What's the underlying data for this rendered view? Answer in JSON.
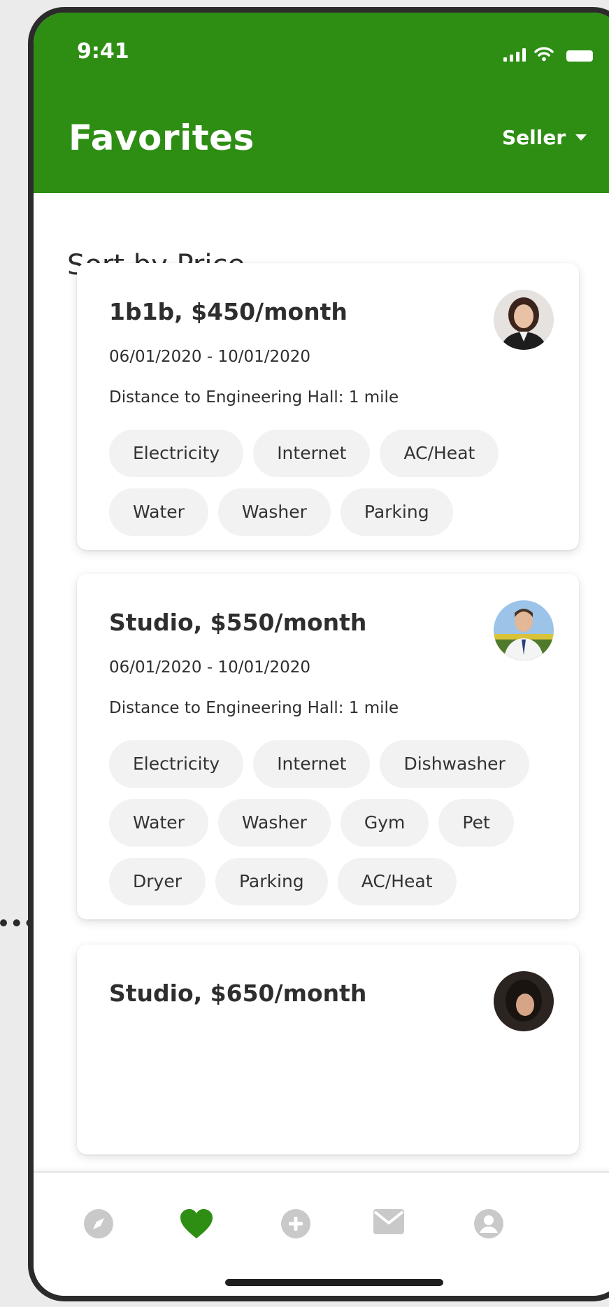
{
  "status": {
    "time": "9:41"
  },
  "header": {
    "title": "Favorites",
    "role": "Seller"
  },
  "sort": {
    "label": "Sort by Price"
  },
  "listings": [
    {
      "title": "1b1b, $450/month",
      "dates": "06/01/2020 - 10/01/2020",
      "distance": "Distance to Engineering Hall: 1 mile",
      "tags": [
        "Electricity",
        "Internet",
        "AC/Heat",
        "Water",
        "Washer",
        "Parking"
      ]
    },
    {
      "title": "Studio, $550/month",
      "dates": "06/01/2020 - 10/01/2020",
      "distance": "Distance to Engineering Hall: 1 mile",
      "tags": [
        "Electricity",
        "Internet",
        "Dishwasher",
        "Water",
        "Washer",
        "Gym",
        "Pet",
        "Dryer",
        "Parking",
        "AC/Heat"
      ]
    },
    {
      "title": "Studio, $650/month"
    }
  ],
  "tabbar": {
    "active": "favorites",
    "items": [
      "explore-icon",
      "heart-icon",
      "add-icon",
      "mail-icon",
      "profile-icon"
    ]
  },
  "colors": {
    "brand": "#2e8e14",
    "inactive_icon": "#c9c9c9"
  }
}
